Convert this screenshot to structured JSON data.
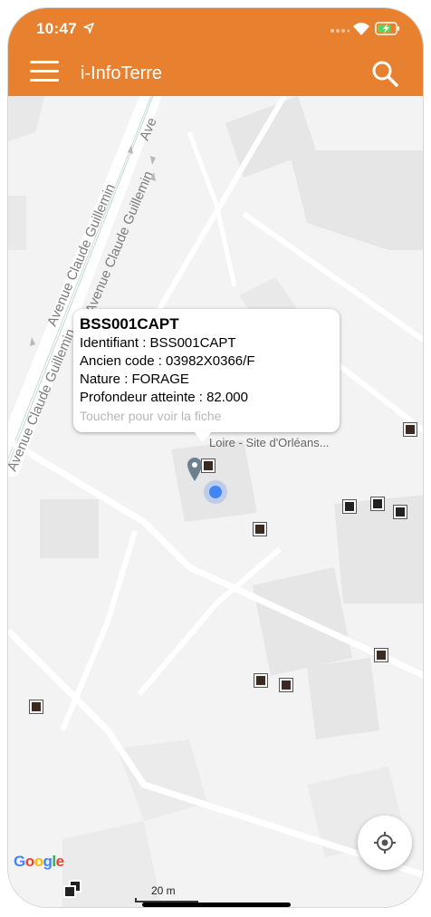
{
  "status_bar": {
    "time": "10:47"
  },
  "app": {
    "title": "i-InfoTerre"
  },
  "map": {
    "streets": [
      "Avenue Claude Guillemin",
      "Avenue Claude Guillemin",
      "Avenue Claude Guillemin",
      "Ave"
    ],
    "place_label": "Loire - Site d'Orléans...",
    "scale_label": "20 m",
    "attribution": "Google"
  },
  "callout": {
    "title": "BSS001CAPT",
    "identifiant": "Identifiant : BSS001CAPT",
    "ancien_code": "Ancien code : 03982X0366/F",
    "nature": "Nature : FORAGE",
    "profondeur": "Profondeur atteinte : 82.000",
    "hint": "Toucher pour voir la fiche"
  },
  "colors": {
    "accent": "#e8812f",
    "user_location": "#4285f4",
    "marker": "#3a2a22"
  }
}
